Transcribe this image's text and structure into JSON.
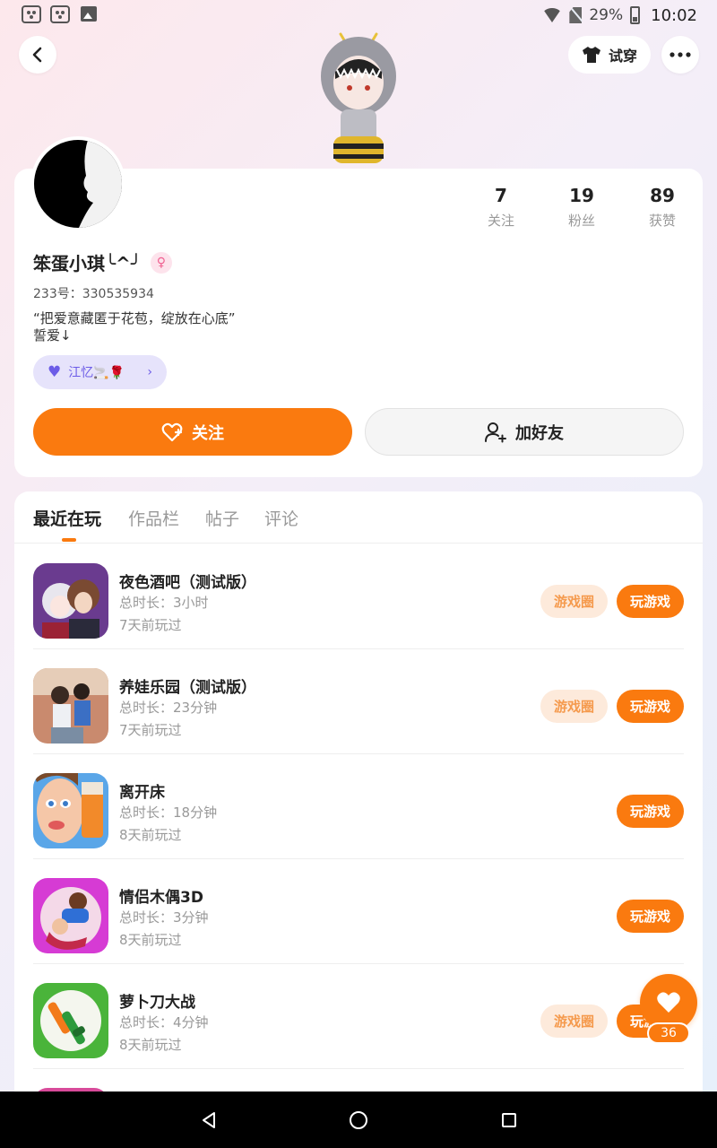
{
  "status_bar": {
    "battery": "29%",
    "time": "10:02"
  },
  "header": {
    "tryon_label": "试穿"
  },
  "profile": {
    "stats": [
      {
        "value": "7",
        "label": "关注"
      },
      {
        "value": "19",
        "label": "粉丝"
      },
      {
        "value": "89",
        "label": "获赞"
      }
    ],
    "username": "笨蛋小琪╰^╯",
    "uid": "233号：330535934",
    "bio_line1": "“把爱意藏匿于花苞，绽放在心底”",
    "bio_line2": "誓爱↓",
    "cp_name": "江忆🚬🌹",
    "follow_label": "关注",
    "add_friend_label": "加好友"
  },
  "tabs": [
    "最近在玩",
    "作品栏",
    "帖子",
    "评论"
  ],
  "games": [
    {
      "title": "夜色酒吧（测试版）",
      "duration": "总时长：3小时",
      "last_played": "7天前玩过",
      "circle_label": "游戏圈",
      "play_label": "玩游戏"
    },
    {
      "title": "养娃乐园（测试版）",
      "duration": "总时长：23分钟",
      "last_played": "7天前玩过",
      "circle_label": "游戏圈",
      "play_label": "玩游戏"
    },
    {
      "title": "离开床",
      "duration": "总时长：18分钟",
      "last_played": "8天前玩过",
      "play_label": "玩游戏"
    },
    {
      "title": "情侣木偶3D",
      "duration": "总时长：3分钟",
      "last_played": "8天前玩过",
      "play_label": "玩游戏"
    },
    {
      "title": "萝卜刀大战",
      "duration": "总时长：4分钟",
      "last_played": "8天前玩过",
      "circle_label": "游戏圈",
      "play_label": "玩游戏"
    }
  ],
  "like_count": "36",
  "colors": {
    "accent": "#fa7a0f",
    "cp_purple": "#6c5ce7"
  }
}
